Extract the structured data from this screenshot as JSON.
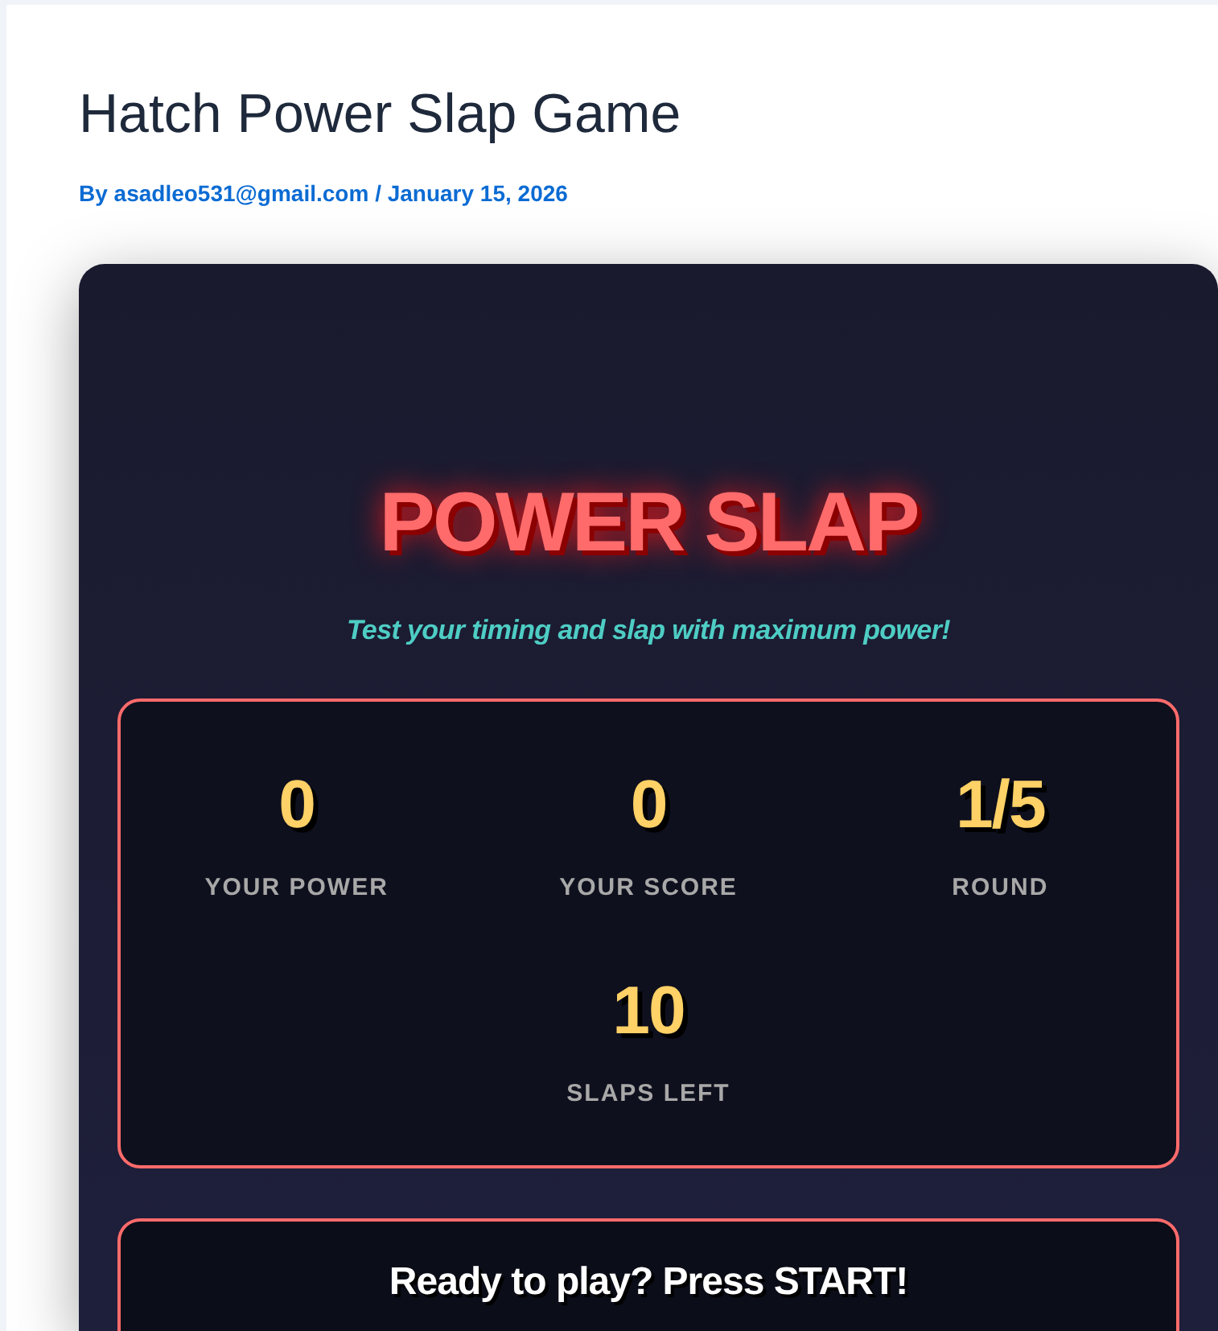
{
  "post": {
    "title": "Hatch Power Slap Game",
    "byline": "By asadleo531@gmail.com / January 15, 2026"
  },
  "game": {
    "title": "POWER SLAP",
    "subtitle": "Test your timing and slap with maximum power!",
    "stats": [
      {
        "value": "0",
        "label": "YOUR POWER"
      },
      {
        "value": "0",
        "label": "YOUR SCORE"
      },
      {
        "value": "1/5",
        "label": "ROUND"
      },
      {
        "value": "10",
        "label": "SLAPS LEFT"
      }
    ],
    "message": "Ready to play? Press START!"
  }
}
